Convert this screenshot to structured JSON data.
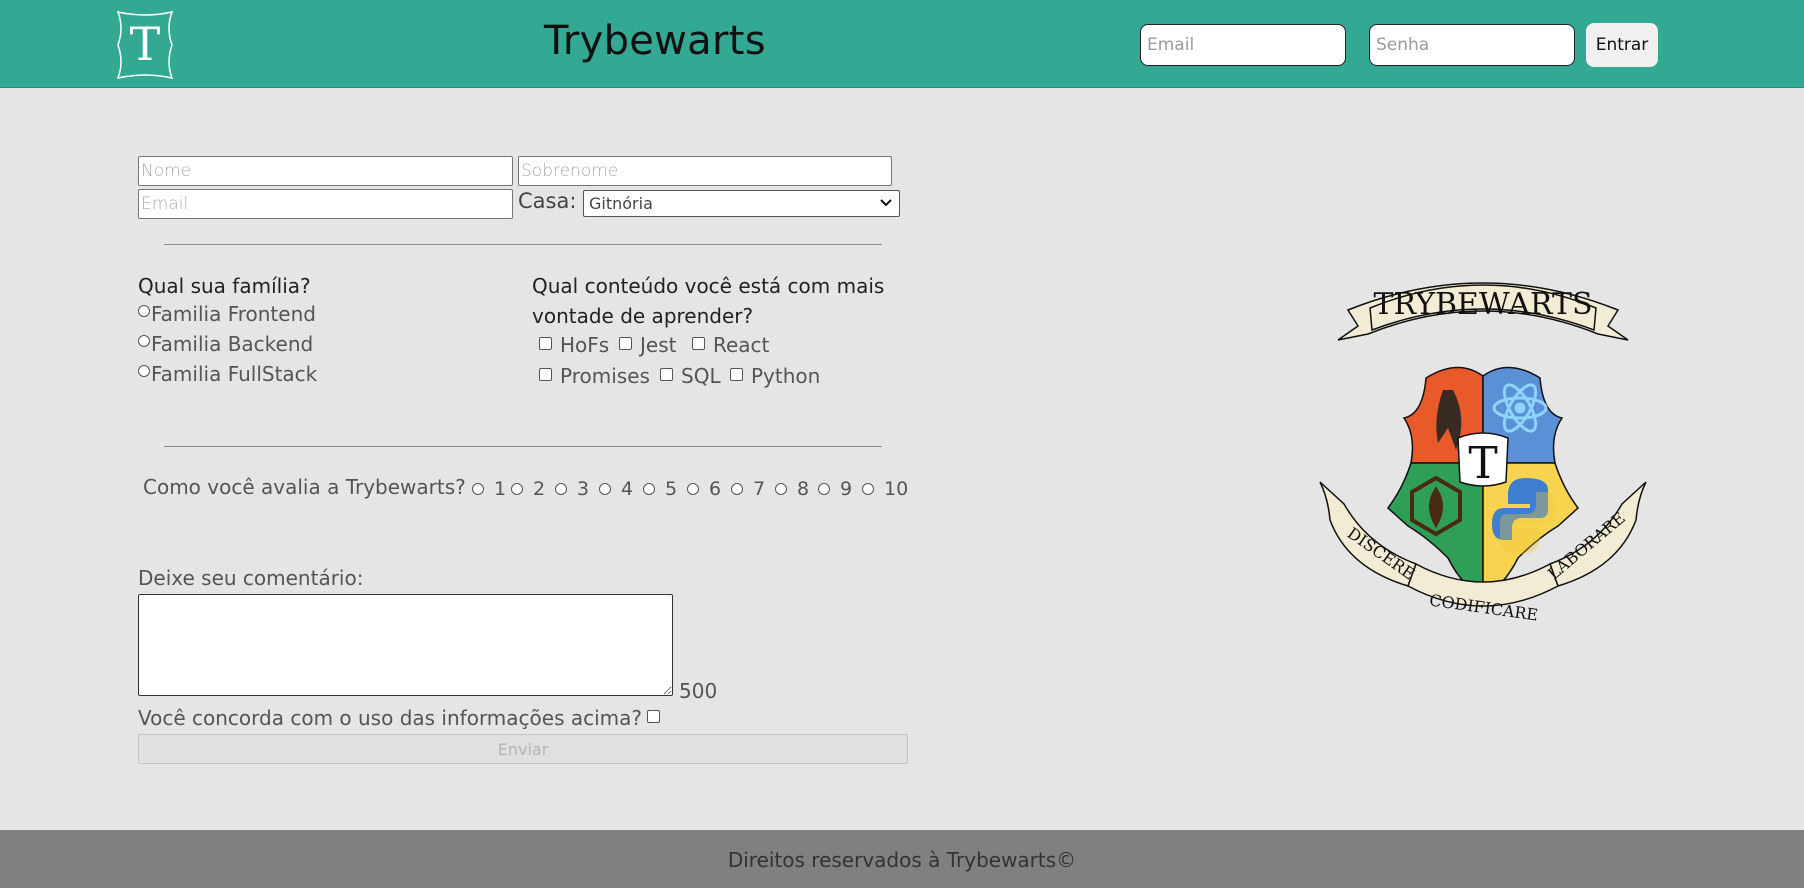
{
  "header": {
    "logo_letter": "T",
    "title": "Trybewarts",
    "login": {
      "email_placeholder": "Email",
      "password_placeholder": "Senha",
      "button_label": "Entrar"
    },
    "background_color": "#33a993"
  },
  "form": {
    "nome_placeholder": "Nome",
    "sobrenome_placeholder": "Sobrenome",
    "email_placeholder": "Email",
    "casa_label": "Casa:",
    "casa_selected": "Gitnória",
    "family": {
      "question": "Qual sua família?",
      "options": [
        "Familia Frontend",
        "Familia Backend",
        "Familia FullStack"
      ]
    },
    "content": {
      "question": "Qual conteúdo você está com mais vontade de aprender?",
      "options": [
        "HoFs",
        "Jest",
        "React",
        "Promises",
        "SQL",
        "Python"
      ]
    },
    "rating": {
      "question": "Como você avalia a Trybewarts?",
      "options": [
        "1",
        "2",
        "3",
        "4",
        "5",
        "6",
        "7",
        "8",
        "9",
        "10"
      ]
    },
    "comment_label": "Deixe seu comentário:",
    "char_counter": "500",
    "agreement_label": "Você concorda com o uso das informações acima?",
    "submit_label": "Enviar"
  },
  "crest": {
    "banner_top": "TRYBEWARTS",
    "center_letter": "T",
    "motto_left": "DISCERE",
    "motto_center": "CODIFICARE",
    "motto_right": "LABORARE"
  },
  "footer": {
    "text": "Direitos reservados à Trybewarts©"
  }
}
